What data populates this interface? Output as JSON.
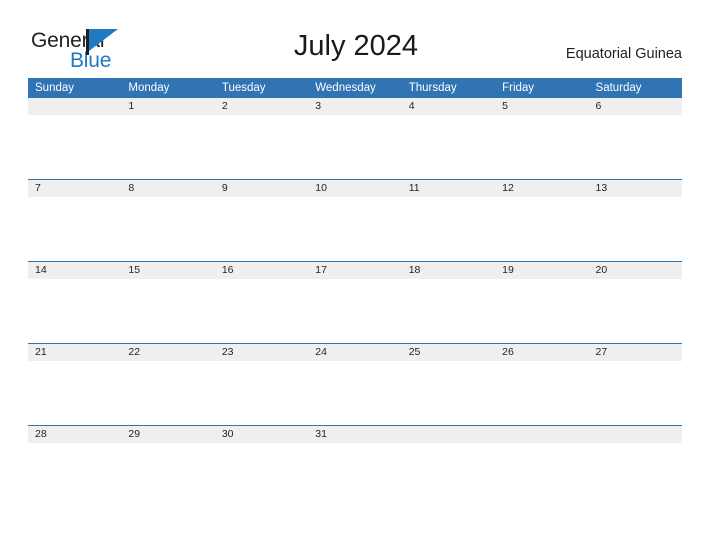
{
  "brand": {
    "word_one": "General",
    "word_two": "Blue",
    "flag_icon": "blue-triangle-flag-icon",
    "dark_color": "#231f20",
    "blue_color": "#1f7ac4"
  },
  "header": {
    "title": "July 2024",
    "locale": "Equatorial Guinea"
  },
  "colors": {
    "header_blue": "#3074b4",
    "row_divider_blue": "#2e75b6",
    "date_band_gray": "#efefef",
    "text": "#231f20"
  },
  "calendar": {
    "month": "July",
    "year": "2024",
    "weekday_headers": [
      "Sunday",
      "Monday",
      "Tuesday",
      "Wednesday",
      "Thursday",
      "Friday",
      "Saturday"
    ],
    "weeks": [
      [
        "",
        "1",
        "2",
        "3",
        "4",
        "5",
        "6"
      ],
      [
        "7",
        "8",
        "9",
        "10",
        "11",
        "12",
        "13"
      ],
      [
        "14",
        "15",
        "16",
        "17",
        "18",
        "19",
        "20"
      ],
      [
        "21",
        "22",
        "23",
        "24",
        "25",
        "26",
        "27"
      ],
      [
        "28",
        "29",
        "30",
        "31",
        "",
        "",
        ""
      ]
    ]
  }
}
